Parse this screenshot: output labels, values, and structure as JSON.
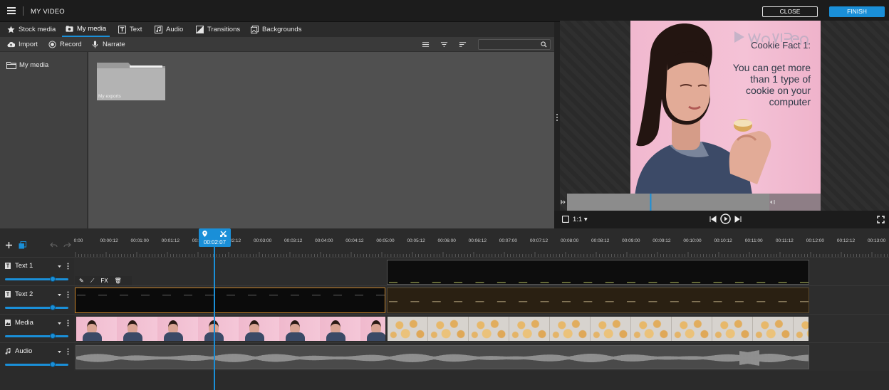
{
  "header": {
    "title": "MY VIDEO",
    "close_label": "CLOSE",
    "finish_label": "FINISH"
  },
  "tabs": [
    {
      "label": "Stock media",
      "icon": "star-icon"
    },
    {
      "label": "My media",
      "icon": "camera-folder-icon",
      "active": true
    },
    {
      "label": "Text",
      "icon": "text-icon"
    },
    {
      "label": "Audio",
      "icon": "music-icon"
    },
    {
      "label": "Transitions",
      "icon": "transitions-icon"
    },
    {
      "label": "Backgrounds",
      "icon": "backgrounds-icon"
    }
  ],
  "toolbar": {
    "import_label": "Import",
    "record_label": "Record",
    "narrate_label": "Narrate",
    "search_placeholder": ""
  },
  "library": {
    "tree_item": "My media",
    "folders": [
      {
        "label": "My exports"
      }
    ]
  },
  "preview": {
    "caption_title": "Cookie Fact 1:",
    "caption_body": "You can get more than 1 type of cookie on your computer",
    "aspect_label": "1:1",
    "progress_fraction": 0.41
  },
  "timeline": {
    "playhead_time": "00:02:07",
    "ruler_labels": [
      "0:00",
      "00:00:12",
      "00:01:00",
      "00:01:12",
      "00:02:00",
      "00:02:12",
      "00:03:00",
      "00:03:12",
      "00:04:00",
      "00:04:12",
      "00:05:00",
      "00:05:12",
      "00:06:00",
      "00:06:12",
      "00:07:00",
      "00:07:12",
      "00:08:00",
      "00:08:12",
      "00:09:00",
      "00:09:12",
      "00:10:00",
      "00:10:12",
      "00:11:00",
      "00:11:12",
      "00:12:00",
      "00:12:12",
      "00:13:00"
    ],
    "clip_tools_fx": "FX",
    "tracks": [
      {
        "name": "Text 1",
        "icon": "text-track-icon",
        "volume": 0.75
      },
      {
        "name": "Text 2",
        "icon": "text-track-icon",
        "volume": 0.75
      },
      {
        "name": "Media",
        "icon": "media-track-icon",
        "volume": 0.75
      },
      {
        "name": "Audio",
        "icon": "music-icon",
        "volume": 0.75
      }
    ]
  },
  "colors": {
    "accent": "#1a8fd8",
    "header_bg": "#1c1c1c",
    "panel_bg": "#505050",
    "selected_clip_border": "#c8842a"
  }
}
